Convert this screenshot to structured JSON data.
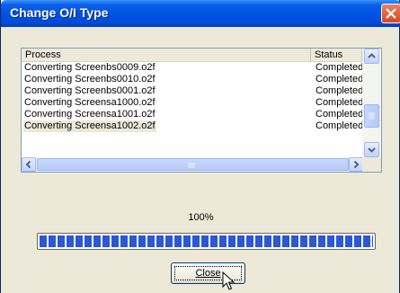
{
  "window": {
    "title": "Change O/I Type"
  },
  "list": {
    "columns": [
      "Process",
      "Status"
    ],
    "rows": [
      {
        "process": "Converting Screenbs0009.o2f",
        "status": "Completed."
      },
      {
        "process": "Converting Screenbs0010.o2f",
        "status": "Completed."
      },
      {
        "process": "Converting Screenbs0001.o2f",
        "status": "Completed."
      },
      {
        "process": "Converting Screensa1000.o2f",
        "status": "Completed."
      },
      {
        "process": "Converting Screensa1001.o2f",
        "status": "Completed."
      },
      {
        "process": "Converting Screensa1002.o2f",
        "status": "Completed."
      }
    ]
  },
  "progress": {
    "label": "100%",
    "value": 1.0,
    "color": "#2c58d4"
  },
  "buttons": {
    "close_label": "Close"
  },
  "icons": {
    "window_close": "close-icon",
    "scroll_up": "arrow-up-icon",
    "scroll_down": "arrow-down-icon",
    "scroll_left": "arrow-left-icon",
    "scroll_right": "arrow-right-icon",
    "cursor": "pointer-icon"
  }
}
